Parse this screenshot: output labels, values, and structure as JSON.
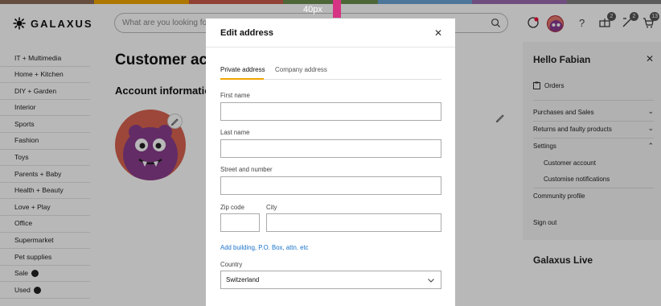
{
  "colorbar": [
    "#8b6b58",
    "#f0a500",
    "#c85a48",
    "#6b8e4e",
    "#6aa3d6",
    "#9b6bb0",
    "#808080"
  ],
  "header": {
    "logo": "GALAXUS",
    "search_placeholder": "What are you looking for?",
    "badges": {
      "compare": "2",
      "cart_items": "2",
      "heart": "13"
    }
  },
  "leftnav": {
    "items": [
      "IT + Multimedia",
      "Home + Kitchen",
      "DIY + Garden",
      "Interior",
      "Sports",
      "Fashion",
      "Toys",
      "Parents + Baby",
      "Health + Beauty",
      "Love + Play",
      "Office",
      "Supermarket",
      "Pet supplies",
      "Sale",
      "Used"
    ]
  },
  "main": {
    "title": "Customer acc",
    "subtitle": "Account information"
  },
  "rightpanel": {
    "hello": "Hello Fabian",
    "orders": "Orders",
    "purchases": "Purchases and Sales",
    "returns": "Returns and faulty products",
    "settings": "Settings",
    "customer_account": "Customer account",
    "notifications": "Customise notifications",
    "community": "Community profile",
    "signout": "Sign out",
    "live": "Galaxus Live"
  },
  "ruler": {
    "label": "40px"
  },
  "modal": {
    "title": "Edit address",
    "tabs": {
      "private": "Private address",
      "company": "Company address"
    },
    "fields": {
      "first_name": "First name",
      "last_name": "Last name",
      "street": "Street and number",
      "zip": "Zip code",
      "city": "City"
    },
    "add_link": "Add building, P.O. Box, attn. etc",
    "country_label": "Country",
    "country_value": "Switzerland"
  }
}
